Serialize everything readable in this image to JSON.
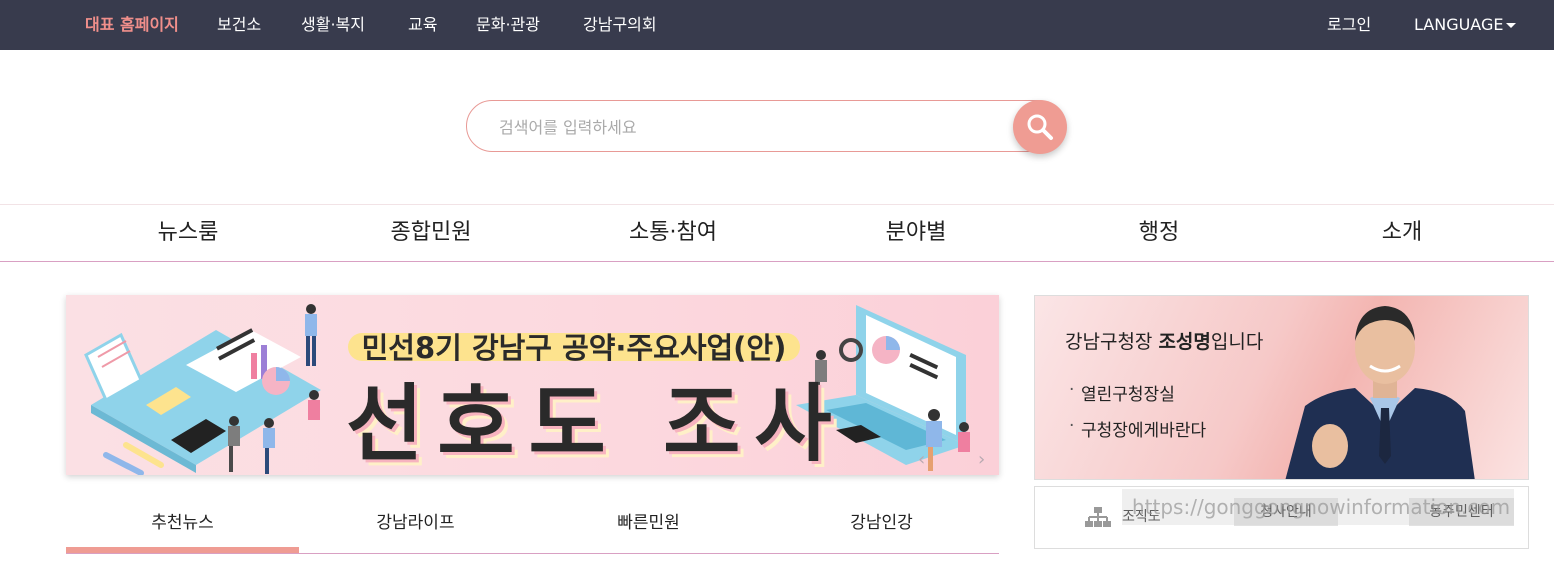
{
  "top_nav": {
    "items": [
      "대표 홈페이지",
      "보건소",
      "생활·복지",
      "교육",
      "문화·관광",
      "강남구의회"
    ],
    "login": "로그인",
    "language": "LANGUAGE"
  },
  "search": {
    "placeholder": "검색어를 입력하세요",
    "icon": "search-icon"
  },
  "main_nav": [
    "뉴스룸",
    "종합민원",
    "소통·참여",
    "분야별",
    "행정",
    "소개"
  ],
  "banner": {
    "subtitle": "민선8기 강남구 공약·주요사업(안)",
    "title": "선호도 조사",
    "prev_icon": "chevron-left-icon",
    "next_icon": "chevron-right-icon"
  },
  "news_tabs": {
    "items": [
      "추천뉴스",
      "강남라이프",
      "빠른민원",
      "강남인강"
    ],
    "active_index": 0
  },
  "mayor_box": {
    "title_prefix": "강남구청장 ",
    "name": "조성명",
    "title_suffix": "입니다",
    "links": [
      "열린구청장실",
      "구청장에게바란다"
    ]
  },
  "quick_links": [
    "조직도",
    "청사안내",
    "동주민센터"
  ],
  "watermark": "https://gonggongnowinformation.com",
  "colors": {
    "topbar_bg": "#383b4d",
    "accent": "#ef9c93",
    "divider": "#d9a0c3"
  }
}
